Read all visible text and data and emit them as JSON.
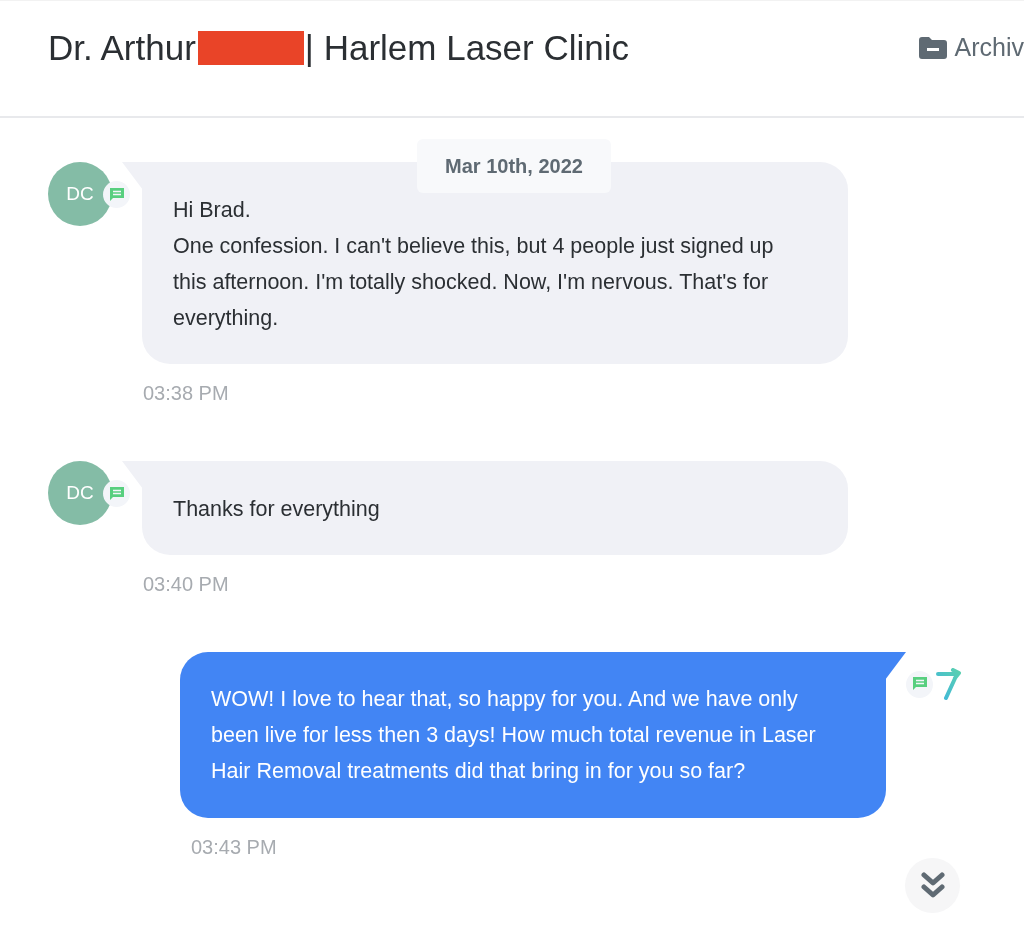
{
  "header": {
    "title_prefix": "Dr. Arthur",
    "redacted": true,
    "title_suffix": "| Harlem Laser Clinic",
    "archive_label": "Archiv"
  },
  "date_divider": "Mar 10th, 2022",
  "messages": [
    {
      "kind": "incoming",
      "avatar": "DC",
      "text": "Hi Brad.\nOne confession. I can't believe this, but 4 people just signed up this afternoon. I'm totally shocked. Now, I'm nervous. That's for everything.",
      "time": "03:38 PM"
    },
    {
      "kind": "incoming",
      "avatar": "DC",
      "text": "Thanks for everything",
      "time": "03:40 PM"
    },
    {
      "kind": "outgoing",
      "text": "WOW! I love to hear that, so happy for you. And we have only been live for less then 3 days! How much total revenue in Laser Hair Removal treatments did that bring in for you so far?",
      "time": "03:43 PM"
    }
  ]
}
